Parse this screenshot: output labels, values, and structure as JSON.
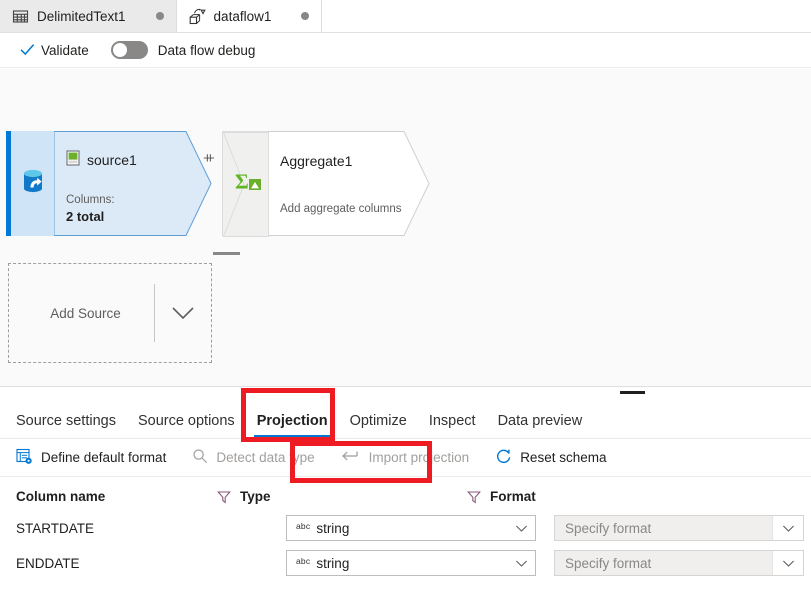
{
  "tabstrip": {
    "tabs": [
      {
        "label": "DelimitedText1",
        "icon": "table-grid-icon",
        "active": false,
        "dirty_dot": true
      },
      {
        "label": "dataflow1",
        "icon": "dataflow-icon",
        "active": true,
        "dirty_dot": true
      }
    ]
  },
  "commandbar": {
    "validate_label": "Validate",
    "validate_icon": "checkmark-icon",
    "debug_toggle_label": "Data flow debug",
    "debug_toggle_on": false
  },
  "canvas": {
    "source_node": {
      "title": "source1",
      "icon": "delimited-text-file-icon",
      "stream_icon": "data-source-cylinder-icon",
      "meta_label": "Columns:",
      "meta_value": "2 total",
      "add_button": "+",
      "accent_color": "#0078d4",
      "fill_color": "#dceaf8"
    },
    "aggregate_node": {
      "title": "Aggregate1",
      "subtitle": "Add aggregate columns",
      "icon": "sigma-aggregate-icon",
      "add_button": "+",
      "icon_color": "#5fb524"
    },
    "add_source": {
      "label": "Add Source",
      "chevron_icon": "chevron-down-icon"
    }
  },
  "panel": {
    "grip": "panel-resize-grip",
    "tabs": [
      {
        "label": "Source settings",
        "selected": false
      },
      {
        "label": "Source options",
        "selected": false
      },
      {
        "label": "Projection",
        "selected": true
      },
      {
        "label": "Optimize",
        "selected": false
      },
      {
        "label": "Inspect",
        "selected": false
      },
      {
        "label": "Data preview",
        "selected": false
      }
    ],
    "accent_color": "#0078d4",
    "actions": [
      {
        "label": "Define default format",
        "icon": "define-format-icon",
        "disabled": false
      },
      {
        "label": "Detect data type",
        "icon": "magnifier-icon",
        "disabled": true
      },
      {
        "label": "Import projection",
        "icon": "import-arrow-icon",
        "disabled": true
      },
      {
        "label": "Reset schema",
        "icon": "refresh-icon",
        "disabled": false
      }
    ],
    "schema_table": {
      "headers": {
        "column_name": "Column name",
        "type": "Type",
        "format": "Format"
      },
      "filter_icon": "filter-funnel-icon",
      "chevron_icon": "chevron-down-icon",
      "type_prefix": "abc",
      "rows": [
        {
          "column_name": "STARTDATE",
          "type": "string",
          "format_placeholder": "Specify format"
        },
        {
          "column_name": "ENDDATE",
          "type": "string",
          "format_placeholder": "Specify format"
        }
      ]
    }
  },
  "annotations": {
    "highlight_color": "#ee1b22",
    "boxes": [
      {
        "target": "Projection tab"
      },
      {
        "target": "Import projection action"
      }
    ]
  }
}
